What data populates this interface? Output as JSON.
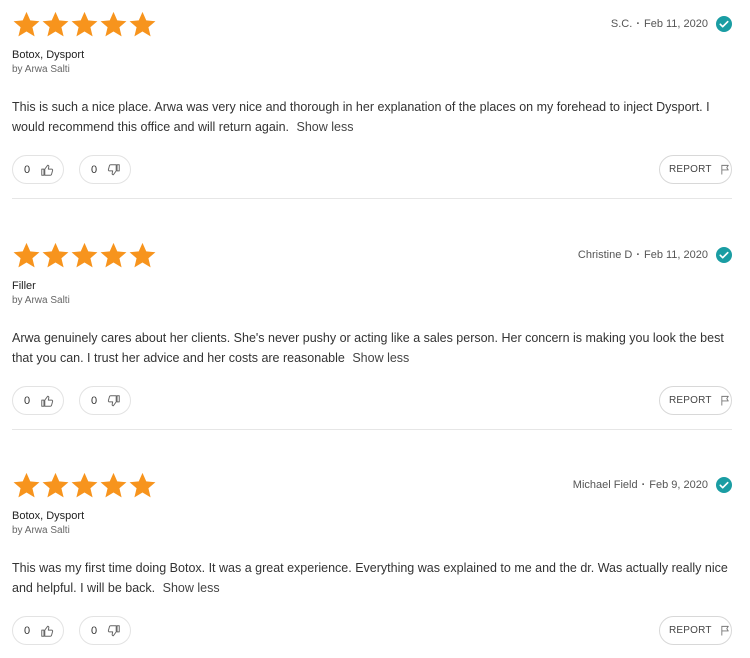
{
  "colors": {
    "star": "#f7941d",
    "verified": "#1a9da3",
    "divider": "#e6e6e6"
  },
  "reviews": [
    {
      "rating": 5,
      "author": "S.C.",
      "date": "Feb 11, 2020",
      "separator": "·",
      "verified_icon": "check-circle-icon",
      "treatment": "Botox, Dysport",
      "provider": "by Arwa Salti",
      "text": "This is such a nice place. Arwa was very nice and thorough in her explanation of the places on my forehead to inject Dysport. I would recommend this office and will return again.",
      "show_less": "Show less",
      "upvotes": "0",
      "downvotes": "0",
      "report_label": "REPORT"
    },
    {
      "rating": 5,
      "author": "Christine D",
      "date": "Feb 11, 2020",
      "separator": "·",
      "verified_icon": "check-circle-icon",
      "treatment": "Filler",
      "provider": "by Arwa Salti",
      "text": "Arwa genuinely cares about her clients. She's never pushy or acting like a sales person. Her concern is making you look the best that you can. I trust her advice and her costs are reasonable",
      "show_less": "Show less",
      "upvotes": "0",
      "downvotes": "0",
      "report_label": "REPORT"
    },
    {
      "rating": 5,
      "author": "Michael Field",
      "date": "Feb 9, 2020",
      "separator": "·",
      "verified_icon": "check-circle-icon",
      "treatment": "Botox, Dysport",
      "provider": "by Arwa Salti",
      "text": "This was my first time doing Botox. It was a great experience. Everything was explained to me and the dr. Was actually really nice and helpful. I will be back.",
      "show_less": "Show less",
      "upvotes": "0",
      "downvotes": "0",
      "report_label": "REPORT"
    }
  ]
}
